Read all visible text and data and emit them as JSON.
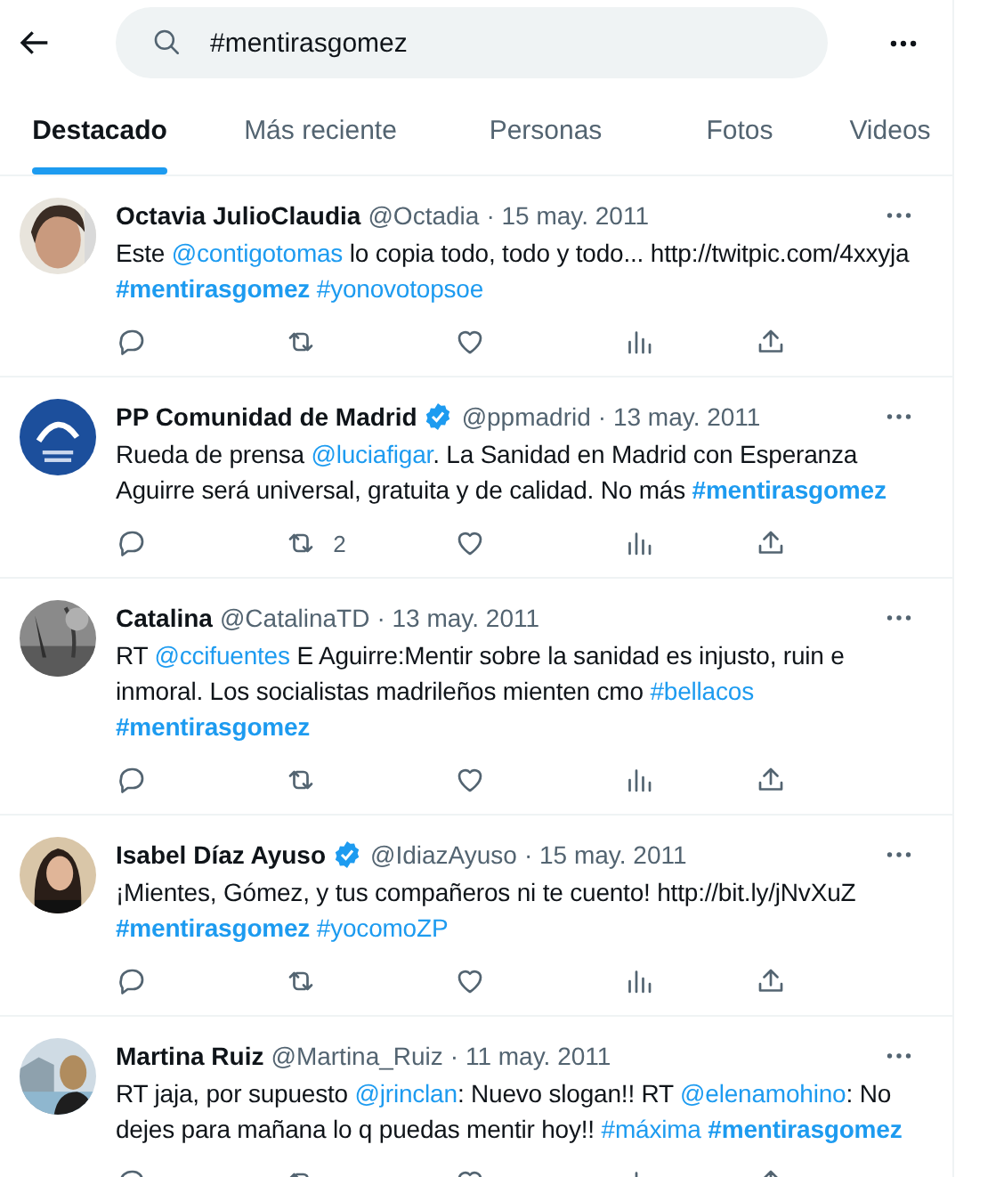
{
  "search": {
    "value": "#mentirasgomez"
  },
  "tabs": [
    {
      "label": "Destacado",
      "selected": true
    },
    {
      "label": "Más reciente",
      "selected": false
    },
    {
      "label": "Personas",
      "selected": false
    },
    {
      "label": "Fotos",
      "selected": false
    },
    {
      "label": "Videos",
      "selected": false
    }
  ],
  "tweets": [
    {
      "name": "Octavia JulioClaudia",
      "verified": false,
      "handle": "@Octadia",
      "date": "· 15 may. 2011",
      "segments": [
        {
          "kind": "text",
          "text": "Este "
        },
        {
          "kind": "link",
          "text": "@contigotomas"
        },
        {
          "kind": "text",
          "text": " lo copia todo, todo y todo... http://twitpic.com/4xxyja "
        },
        {
          "kind": "match",
          "text": "#mentirasgomez"
        },
        {
          "kind": "link",
          "text": "#yonovotopsoe"
        }
      ]
    },
    {
      "name": "PP Comunidad de Madrid",
      "verified": true,
      "handle": "@ppmadrid",
      "date": "· 13 may. 2011",
      "retweets": "2",
      "segments": [
        {
          "kind": "text",
          "text": "Rueda de prensa "
        },
        {
          "kind": "link",
          "text": "@luciafigar"
        },
        {
          "kind": "text",
          "text": ". La Sanidad en Madrid con Esperanza Aguirre será universal, gratuita y de calidad. No más "
        },
        {
          "kind": "match",
          "text": "#mentirasgomez"
        }
      ]
    },
    {
      "name": "Catalina",
      "verified": false,
      "handle": "@CatalinaTD",
      "date": "· 13 may. 2011",
      "segments": [
        {
          "kind": "text",
          "text": "RT "
        },
        {
          "kind": "link",
          "text": "@ccifuentes"
        },
        {
          "kind": "text",
          "text": " E Aguirre:Mentir sobre la sanidad es injusto, ruin e inmoral. Los socialistas madrileños mienten cmo "
        },
        {
          "kind": "link",
          "text": "#bellacos"
        },
        {
          "kind": "match",
          "text": "#mentirasgomez"
        }
      ]
    },
    {
      "name": "Isabel Díaz Ayuso",
      "verified": true,
      "handle": "@IdiazAyuso",
      "date": "· 15 may. 2011",
      "segments": [
        {
          "kind": "text",
          "text": "¡Mientes, Gómez, y tus compañeros ni te cuento! http://bit.ly/jNvXuZ "
        },
        {
          "kind": "match",
          "text": "#mentirasgomez"
        },
        {
          "kind": "link",
          "text": "#yocomoZP"
        }
      ]
    },
    {
      "name": "Martina Ruiz",
      "verified": false,
      "handle": "@Martina_Ruiz",
      "date": "· 11 may. 2011",
      "segments": [
        {
          "kind": "text",
          "text": "RT jaja, por supuesto "
        },
        {
          "kind": "link",
          "text": "@jrinclan"
        },
        {
          "kind": "text",
          "text": ": Nuevo slogan!! RT "
        },
        {
          "kind": "link",
          "text": "@elenamohino"
        },
        {
          "kind": "text",
          "text": ": No dejes para mañana lo q puedas mentir hoy!! "
        },
        {
          "kind": "link",
          "text": "#máxima"
        },
        {
          "kind": "match",
          "text": "#mentirasgomez"
        }
      ]
    }
  ]
}
